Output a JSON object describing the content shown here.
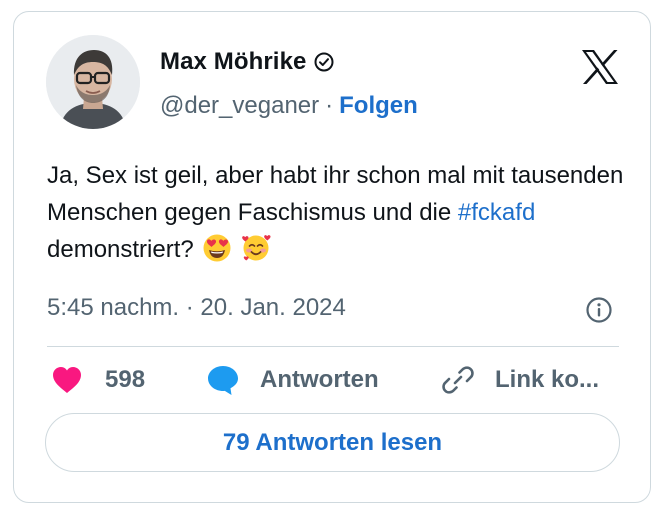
{
  "author": {
    "name": "Max Möhrike",
    "handle": "@der_veganer",
    "separator": "·",
    "follow_label": "Folgen"
  },
  "tweet": {
    "text_before": "Ja, Sex ist geil, aber habt ihr schon mal mit tausenden Menschen gegen Faschismus und die ",
    "hashtag": "#fckafd",
    "text_after": " demonstriert?",
    "emojis": [
      "smiling-face-with-heart-eyes",
      "smiling-face-with-hearts"
    ],
    "timestamp": "5:45 nachm. · 20. Jan. 2024"
  },
  "actions": {
    "likes": "598",
    "reply_label": "Antworten",
    "copy_label": "Link ko..."
  },
  "read_replies_label": "79 Antworten lesen",
  "icons": [
    "verified-icon",
    "x-logo-icon",
    "info-icon",
    "heart-icon",
    "reply-bubble-icon",
    "link-icon"
  ],
  "colors": {
    "link": "#1d6fcb",
    "heart": "#f91880",
    "reply_bubble": "#1d9bf0",
    "muted": "#536471",
    "border": "#cfd9de"
  }
}
